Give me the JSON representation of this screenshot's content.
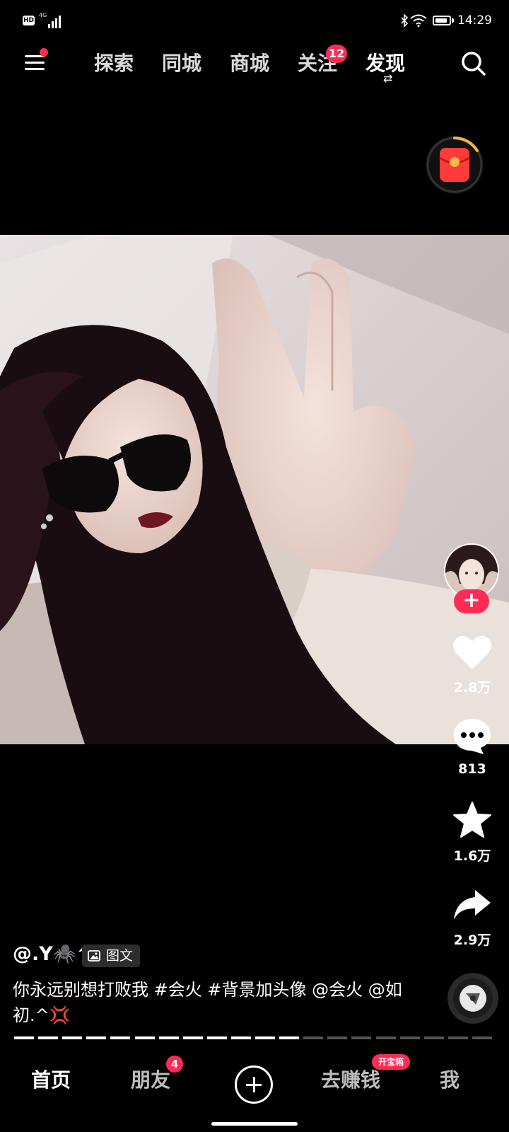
{
  "status_bar": {
    "hd_label": "HD",
    "network_label": "4G",
    "time": "14:29"
  },
  "top_nav": {
    "tabs": [
      {
        "label": "探索"
      },
      {
        "label": "同城"
      },
      {
        "label": "商城"
      },
      {
        "label": "关注",
        "badge": "12"
      },
      {
        "label": "发现"
      }
    ],
    "active_tab": "发现",
    "switch_glyph": "⇄"
  },
  "post": {
    "author": "@.Y🕷️^",
    "type_label": "图文",
    "caption": "你永远别想打败我 #会火 #背景加头像 @会火 @如初.^💢"
  },
  "actions": {
    "follow_glyph": "+",
    "likes": "2.8万",
    "comments": "813",
    "favorites": "1.6万",
    "shares": "2.9万"
  },
  "bottom_nav": {
    "home": "首页",
    "friends": "朋友",
    "friends_badge": "4",
    "earn": "去赚钱",
    "earn_badge": "开宝箱",
    "me": "我"
  },
  "colors": {
    "accent": "#fe2c55",
    "background": "#000000"
  },
  "image_progress": {
    "total_pages": 20,
    "current_page": 12
  }
}
